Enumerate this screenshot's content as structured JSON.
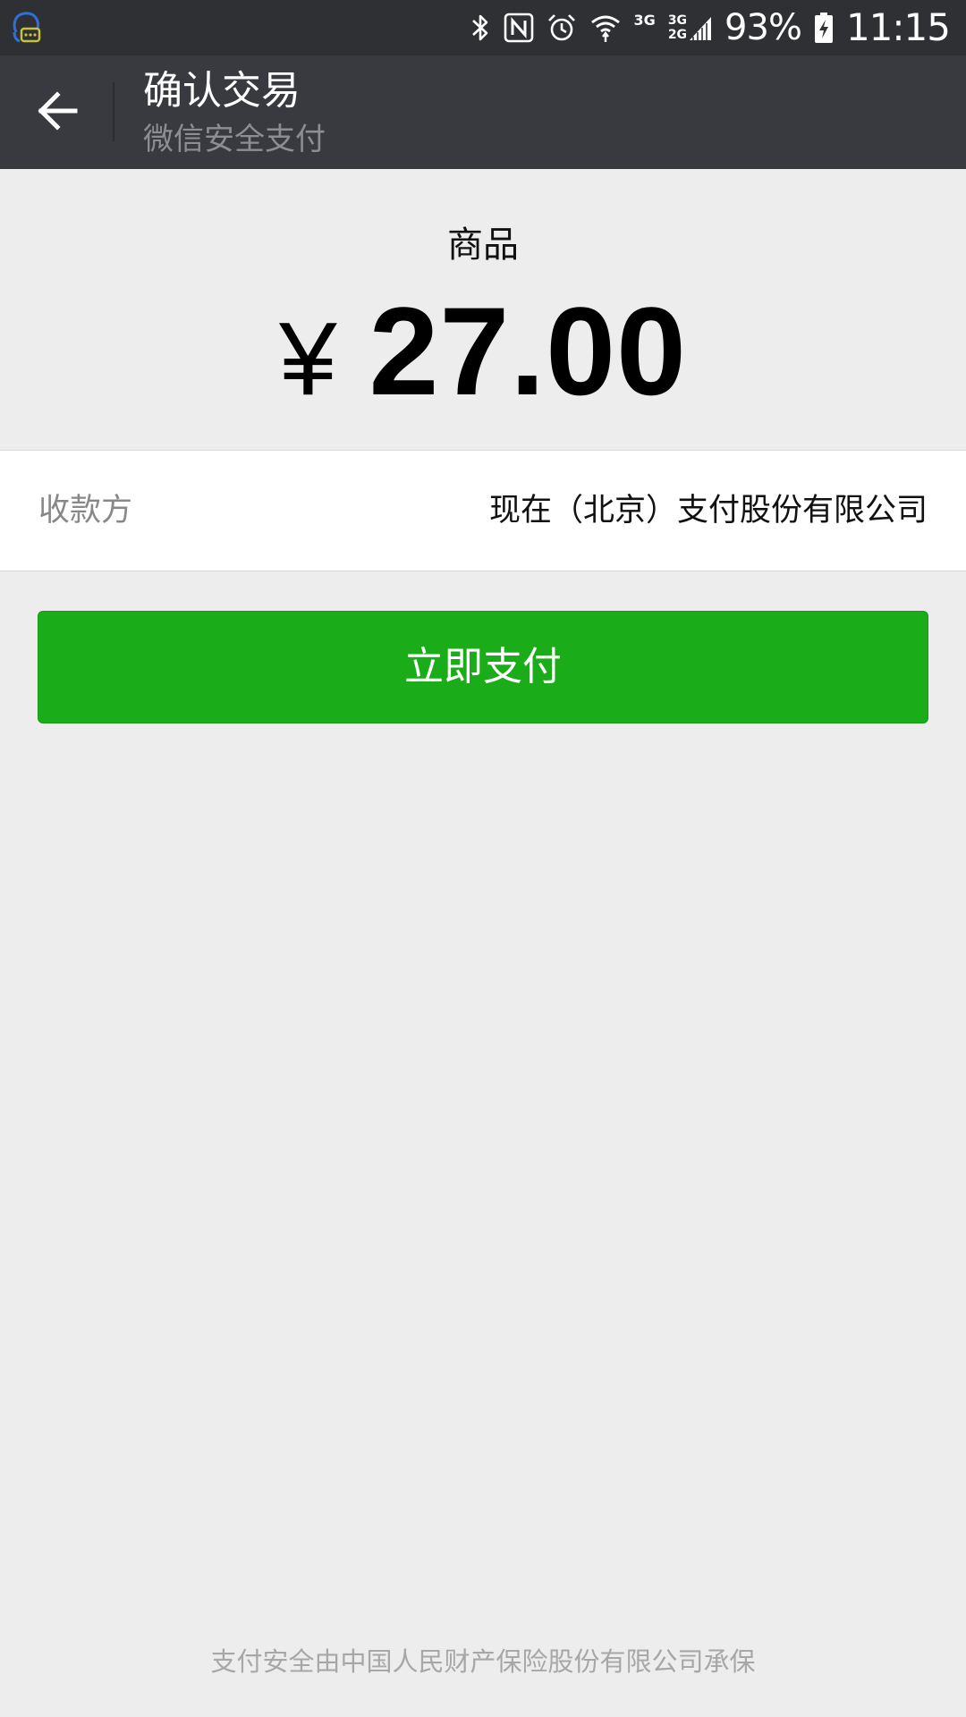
{
  "status_bar": {
    "network_top": "3G",
    "network_dual_top": "3G",
    "network_dual_bottom": "2G",
    "battery": "93%",
    "time": "11:15",
    "icons": [
      "chat-notification-icon",
      "bluetooth-icon",
      "nfc-icon",
      "alarm-icon",
      "wifi-icon",
      "signal-icon",
      "battery-charging-icon"
    ]
  },
  "title_bar": {
    "title": "确认交易",
    "subtitle": "微信安全支付",
    "back_icon": "arrow-left-icon"
  },
  "order": {
    "product_label": "商品",
    "currency_symbol": "¥",
    "amount": "27.00"
  },
  "payee": {
    "label": "收款方",
    "value": "现在（北京）支付股份有限公司"
  },
  "actions": {
    "pay_label": "立即支付"
  },
  "footer": {
    "note": "支付安全由中国人民财产保险股份有限公司承保"
  },
  "colors": {
    "status_bar_bg": "#2f3034",
    "title_bar_bg": "#393a3f",
    "page_bg": "#ededed",
    "pay_button_bg": "#1aad19",
    "notification_icon": "#2f6fd6"
  }
}
